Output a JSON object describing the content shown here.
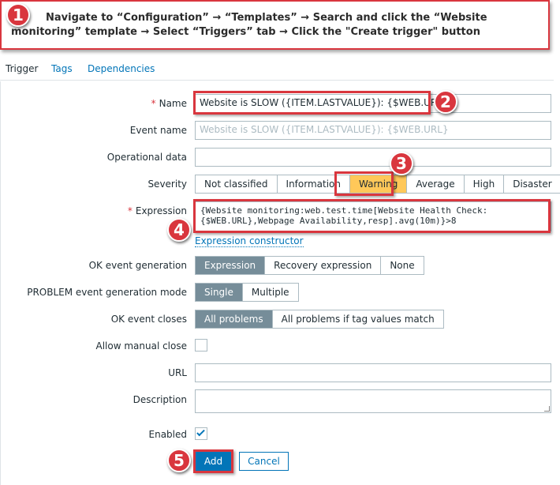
{
  "banner": {
    "step": "1",
    "text": "Navigate to “Configuration” → “Templates” → Search and click the “Website monitoring” template → Select “Triggers” tab → Click the \"Create trigger\" button"
  },
  "steps": [
    "2",
    "3",
    "4",
    "5"
  ],
  "tabs": [
    "Trigger",
    "Tags",
    "Dependencies"
  ],
  "required_marker": "*",
  "form": {
    "name": {
      "label": "Name",
      "value": "Website is SLOW ({ITEM.LASTVALUE}): {$WEB.URL}"
    },
    "event_name": {
      "label": "Event name",
      "placeholder": "Website is SLOW ({ITEM.LASTVALUE}): {$WEB.URL}"
    },
    "operational_data": {
      "label": "Operational data",
      "value": ""
    },
    "severity": {
      "label": "Severity",
      "options": [
        "Not classified",
        "Information",
        "Warning",
        "Average",
        "High",
        "Disaster"
      ],
      "selected": "Warning"
    },
    "expression": {
      "label": "Expression",
      "value": "{Website monitoring:web.test.time[Website Health Check:\n{$WEB.URL},Webpage Availability,resp].avg(10m)}>8",
      "constructor_link": "Expression constructor"
    },
    "ok_event_generation": {
      "label": "OK event generation",
      "options": [
        "Expression",
        "Recovery expression",
        "None"
      ],
      "selected": "Expression"
    },
    "problem_generation_mode": {
      "label": "PROBLEM event generation mode",
      "options": [
        "Single",
        "Multiple"
      ],
      "selected": "Single"
    },
    "ok_event_closes": {
      "label": "OK event closes",
      "options": [
        "All problems",
        "All problems if tag values match"
      ],
      "selected": "All problems"
    },
    "allow_manual_close": {
      "label": "Allow manual close",
      "checked": false
    },
    "url": {
      "label": "URL",
      "value": ""
    },
    "description": {
      "label": "Description",
      "value": ""
    },
    "enabled": {
      "label": "Enabled",
      "checked": true
    }
  },
  "buttons": {
    "add": "Add",
    "cancel": "Cancel"
  },
  "colors": {
    "accent": "#0275b8",
    "highlight": "#d9363e",
    "warning": "#ffc859",
    "selected": "#768d99"
  }
}
